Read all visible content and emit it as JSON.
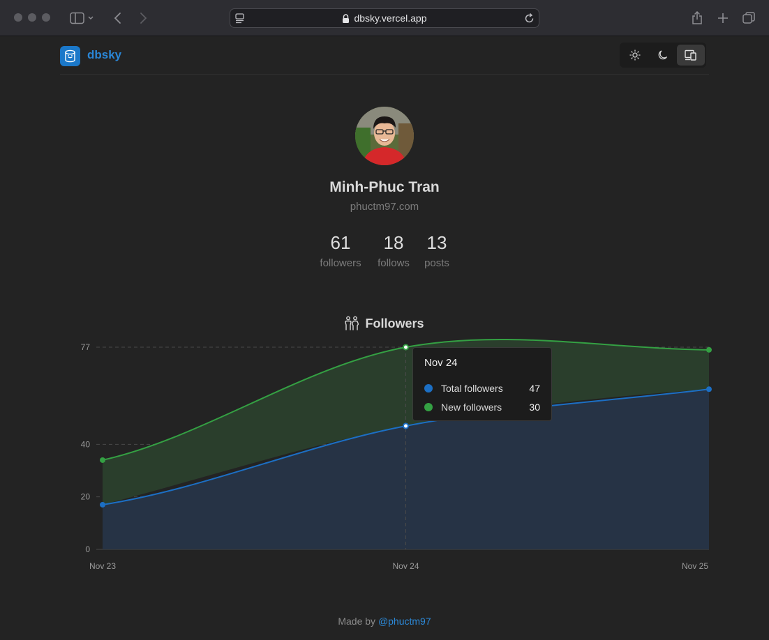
{
  "browser": {
    "url": "dbsky.vercel.app"
  },
  "app": {
    "name": "dbsky",
    "theme_options": [
      "light",
      "dark",
      "system"
    ],
    "active_theme": "system"
  },
  "profile": {
    "name": "Minh-Phuc Tran",
    "handle": "phuctm97.com",
    "stats": [
      {
        "value": "61",
        "label": "followers"
      },
      {
        "value": "18",
        "label": "follows"
      },
      {
        "value": "13",
        "label": "posts"
      }
    ]
  },
  "section": {
    "title": "Followers"
  },
  "chart_data": {
    "type": "area",
    "stacked": true,
    "categories": [
      "Nov 23",
      "Nov 24",
      "Nov 25"
    ],
    "series": [
      {
        "name": "Total followers",
        "values": [
          17,
          47,
          61
        ],
        "color": "#1c6fc4"
      },
      {
        "name": "New followers",
        "values": [
          17,
          30,
          15
        ],
        "color": "#34a043"
      }
    ],
    "y_ticks": [
      "0",
      "20",
      "40",
      "77"
    ],
    "ylim": [
      0,
      77
    ],
    "grid": true
  },
  "tooltip": {
    "title": "Nov 24",
    "rows": [
      {
        "label": "Total followers",
        "value": "47",
        "color": "#1c6fc4"
      },
      {
        "label": "New followers",
        "value": "30",
        "color": "#34a043"
      }
    ]
  },
  "footer": {
    "prefix": "Made by",
    "link": "@phuctm97"
  }
}
